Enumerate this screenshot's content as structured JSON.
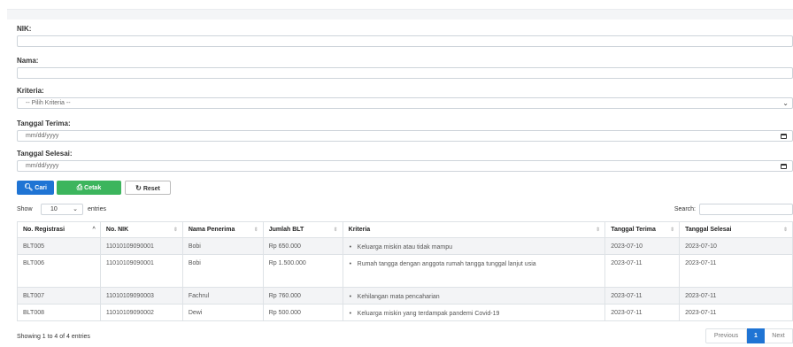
{
  "form": {
    "nik_label": "NIK:",
    "nama_label": "Nama:",
    "kriteria_label": "Kriteria:",
    "kriteria_value": "-- Pilih Kriteria --",
    "tanggal_terima_label": "Tanggal Terima:",
    "tanggal_terima_placeholder": "mm/dd/yyyy",
    "tanggal_selesai_label": "Tanggal Selesai:",
    "tanggal_selesai_placeholder": "mm/dd/yyyy"
  },
  "buttons": {
    "cari": "Cari",
    "cetak": "Cetak",
    "reset": "Reset"
  },
  "table_controls": {
    "show_label": "Show",
    "page_length": "10",
    "entries_label": "entries",
    "search_label": "Search:"
  },
  "table": {
    "columns": [
      "No. Registrasi",
      "No. NIK",
      "Nama Penerima",
      "Jumlah BLT",
      "Kriteria",
      "Tanggal Terima",
      "Tanggal Selesai"
    ],
    "rows": [
      {
        "reg": "BLT005",
        "nik": "11010109090001",
        "nama": "Bobi",
        "jumlah": "Rp 650.000",
        "kriteria": "Keluarga miskin atau tidak mampu",
        "terima": "2023-07-10",
        "selesai": "2023-07-10"
      },
      {
        "reg": "BLT006",
        "nik": "11010109090001",
        "nama": "Bobi",
        "jumlah": "Rp 1.500.000",
        "kriteria": "Rumah tangga dengan anggota rumah tangga tunggal lanjut usia",
        "terima": "2023-07-11",
        "selesai": "2023-07-11"
      },
      {
        "reg": "BLT007",
        "nik": "11010109090003",
        "nama": "Fachrul",
        "jumlah": "Rp 760.000",
        "kriteria": "Kehilangan mata pencaharian",
        "terima": "2023-07-11",
        "selesai": "2023-07-11"
      },
      {
        "reg": "BLT008",
        "nik": "11010109090002",
        "nama": "Dewi",
        "jumlah": "Rp 500.000",
        "kriteria": "Keluarga miskin yang terdampak pandemi Covid-19",
        "terima": "2023-07-11",
        "selesai": "2023-07-11"
      }
    ]
  },
  "footer": {
    "info": "Showing 1 to 4 of 4 entries",
    "previous": "Previous",
    "current_page": "1",
    "next": "Next"
  },
  "colors": {
    "primary": "#1f74d4",
    "success": "#3cb55d"
  }
}
